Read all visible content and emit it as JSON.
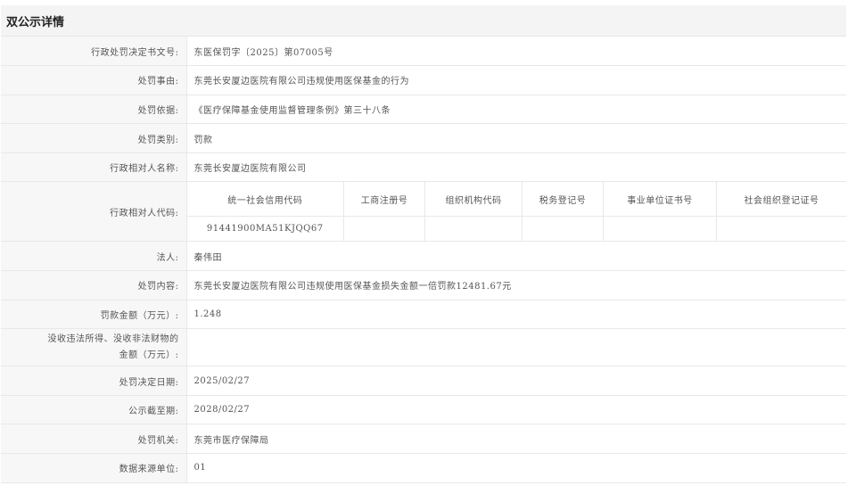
{
  "header": {
    "title": "双公示详情"
  },
  "rows_top": [
    {
      "label": "行政处罚决定书文号:",
      "value": "东医保罚字〔2025〕第07005号"
    },
    {
      "label": "处罚事由:",
      "value": "东莞长安厦边医院有限公司违规使用医保基金的行为"
    },
    {
      "label": "处罚依据:",
      "value": "《医疗保障基金使用监督管理条例》第三十八条"
    },
    {
      "label": "处罚类别:",
      "value": "罚款"
    },
    {
      "label": "行政相对人名称:",
      "value": "东莞长安厦边医院有限公司"
    }
  ],
  "code_block": {
    "label": "行政相对人代码:",
    "columns": [
      "统一社会信用代码",
      "工商注册号",
      "组织机构代码",
      "税务登记号",
      "事业单位证书号",
      "社会组织登记证号"
    ],
    "values": [
      "91441900MA51KJQQ67",
      "",
      "",
      "",
      "",
      ""
    ]
  },
  "rows_mid": [
    {
      "label": "法人:",
      "value": "秦伟田"
    },
    {
      "label": "处罚内容:",
      "value": "东莞长安厦边医院有限公司违规使用医保基金损失金额一倍罚款12481.67元"
    },
    {
      "label": "罚款金额（万元）:",
      "value": "1.248"
    }
  ],
  "confiscation": {
    "label_line1": "没收违法所得、没收非法财物的",
    "label_line2": "金额（万元）:",
    "value": ""
  },
  "rows_bottom": [
    {
      "label": "处罚决定日期:",
      "value": "2025/02/27"
    },
    {
      "label": "公示截至期:",
      "value": "2028/02/27"
    },
    {
      "label": "处罚机关:",
      "value": "东莞市医疗保障局"
    },
    {
      "label": "数据来源单位:",
      "value": "01"
    }
  ]
}
